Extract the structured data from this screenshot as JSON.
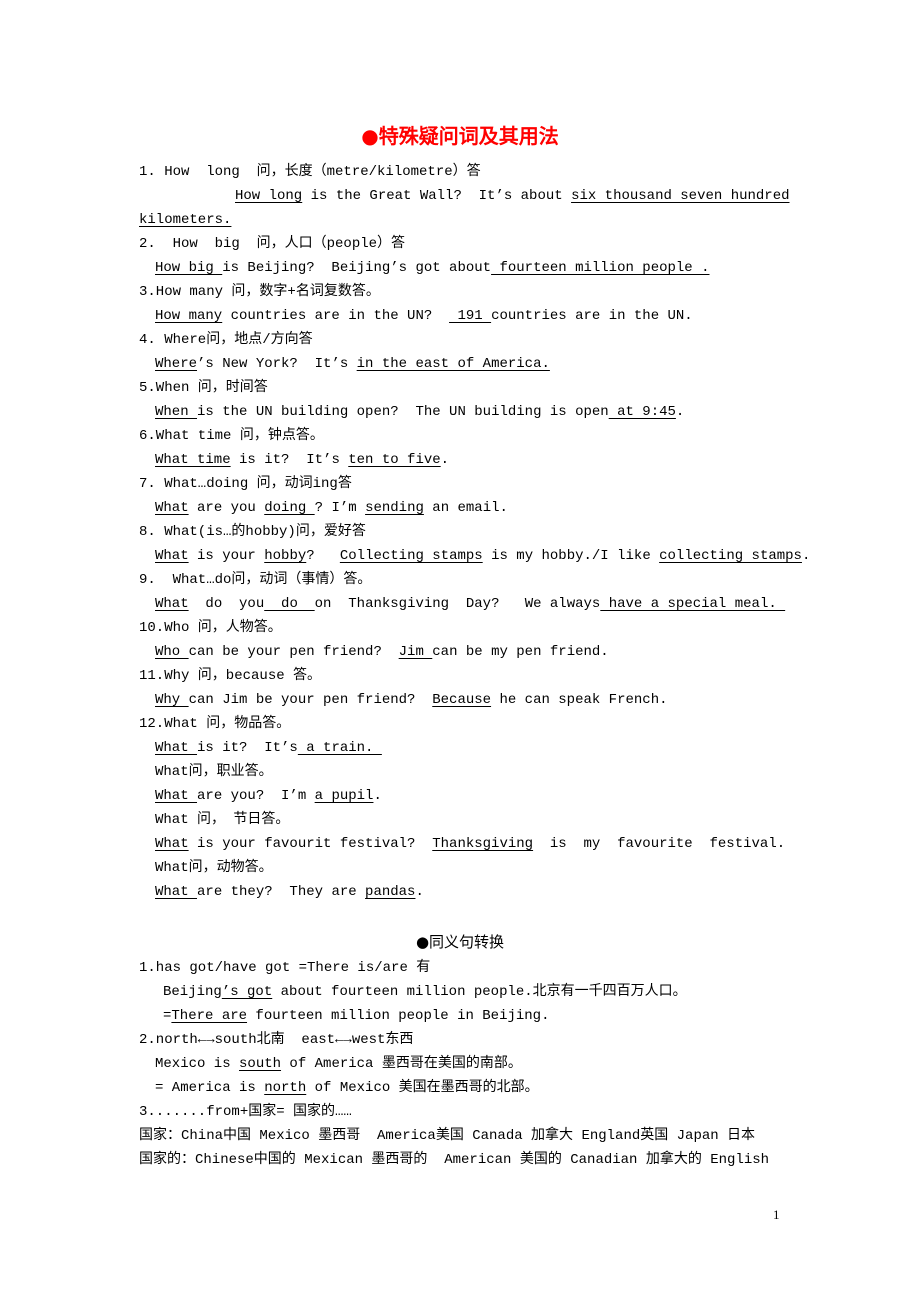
{
  "title": "●特殊疑问词及其用法",
  "items": [
    {
      "head": "1. How  long  问，长度（metre/kilometre）答",
      "ex": [
        "",
        "How long",
        " is the Great Wall?  It’s about ",
        "six thousand seven hundred"
      ],
      "ex_cont": "kilometers."
    },
    {
      "head": "2.  How  big  问，人口（people）答",
      "ex": [
        "",
        "How big ",
        "is Beijing?  Beijing’s got about",
        " fourteen million people ."
      ]
    },
    {
      "head": "3.How many 问，数字+名词复数答。",
      "ex": [
        "",
        "How many",
        " countries are in the UN?  ",
        " 191 ",
        "countries are in the UN."
      ]
    },
    {
      "head": "4. Where问，地点/方向答",
      "ex": [
        "",
        "Where",
        "’s New York?  It’s ",
        "in the east of America."
      ]
    },
    {
      "head": "5.When 问，时间答",
      "ex": [
        "",
        "When ",
        "is the UN building open?  The UN building is open",
        " at 9:45",
        "."
      ]
    },
    {
      "head": "6.What time 问，钟点答。",
      "ex": [
        "",
        "What time",
        " is it?  It’s ",
        "ten to five",
        "."
      ]
    },
    {
      "head": "7. What…doing 问，动词ing答",
      "ex": [
        "",
        "What",
        " are you ",
        "doing ",
        "? I’m ",
        "sending",
        " an email."
      ]
    },
    {
      "head": "8. What(is…的hobby)问，爱好答",
      "ex": [
        "",
        "What",
        " is your ",
        "hobby",
        "?   ",
        "Collecting stamps",
        " is my hobby./I like ",
        "collecting stamps",
        "."
      ]
    },
    {
      "head": "9.  What…do问，动词（事情）答。",
      "ex": [
        "",
        "What",
        "  do  you",
        "  do  ",
        "on  Thanksgiving  Day?   We always",
        " have a special meal. "
      ]
    },
    {
      "head": "10.Who 问，人物答。",
      "ex": [
        "",
        "Who ",
        "can be your pen friend?  ",
        "Jim ",
        "can be my pen friend."
      ]
    },
    {
      "head": "11.Why 问，because 答。",
      "ex": [
        "",
        "Why ",
        "can Jim be your pen friend?  ",
        "Because",
        " he can speak French."
      ]
    },
    {
      "head": "12.What 问，物品答。",
      "ex": [
        "",
        "What ",
        "is it?  It’s",
        " a train. "
      ]
    }
  ],
  "what_extra": [
    {
      "head": "What问，职业答。",
      "ex": [
        "",
        "What ",
        "are you?  I’m ",
        "a pupil",
        "."
      ]
    },
    {
      "head": "What 问， 节日答。",
      "ex": [
        "",
        "What",
        " is your favourit festival?  ",
        "Thanksgiving",
        "  is  my  favourite  festival."
      ]
    },
    {
      "head": "What问，动物答。",
      "ex": [
        "",
        "What ",
        "are they?  They are ",
        "pandas",
        "."
      ]
    }
  ],
  "section2": {
    "title": "●同义句转换",
    "l1": "1.has got/have got =There is/are 有",
    "l1a": [
      "Beijing",
      "’s got",
      " about fourteen million people.北京有一千四百万人口。"
    ],
    "l1b": [
      "=",
      "There are",
      " fourteen million people in Beijing."
    ],
    "l2": "2.north←→south北南  east←→west东西",
    "l2a": [
      "Mexico is ",
      "south",
      " of America 墨西哥在美国的南部。"
    ],
    "l2b": [
      "= America is ",
      "north",
      " of Mexico 美国在墨西哥的北部。"
    ],
    "l3": "3.......from+国家= 国家的……",
    "l4": "国家：China中国 Mexico 墨西哥  America美国 Canada 加拿大 England英国 Japan 日本",
    "l5": "国家的：Chinese中国的 Mexican 墨西哥的  American 美国的 Canadian 加拿大的 English"
  },
  "page_number": "1"
}
